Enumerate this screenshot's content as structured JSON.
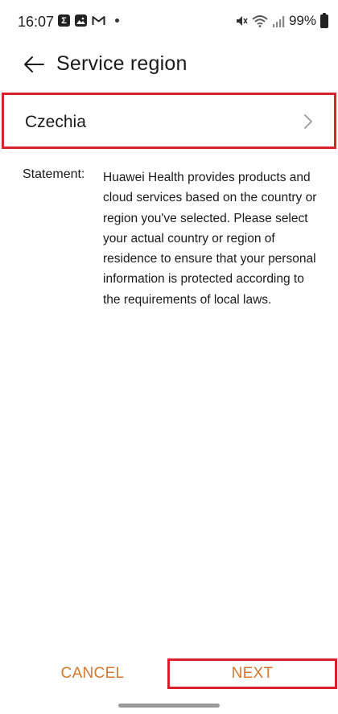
{
  "status_bar": {
    "time": "16:07",
    "battery": "99%",
    "left_icons": [
      "sigma-notification-icon",
      "gallery-notification-icon",
      "gmail-icon",
      "dot-icon"
    ],
    "right_icons": [
      "mute-icon",
      "wifi-icon",
      "signal-icon",
      "battery-icon"
    ]
  },
  "header": {
    "title": "Service region",
    "back_icon": "back-arrow-icon"
  },
  "region": {
    "value": "Czechia",
    "chevron_icon": "chevron-right-icon"
  },
  "statement": {
    "label": "Statement:",
    "text": "Huawei Health provides products and cloud services based on the country or region you've selected. Please select your actual country or region of residence to ensure that your personal information is protected according to the requirements of local laws."
  },
  "buttons": {
    "cancel": "CANCEL",
    "next": "NEXT"
  },
  "colors": {
    "accent": "#d4782f",
    "highlight_border": "#d9212c",
    "text": "#1a1a1a",
    "background": "#ffffff"
  }
}
